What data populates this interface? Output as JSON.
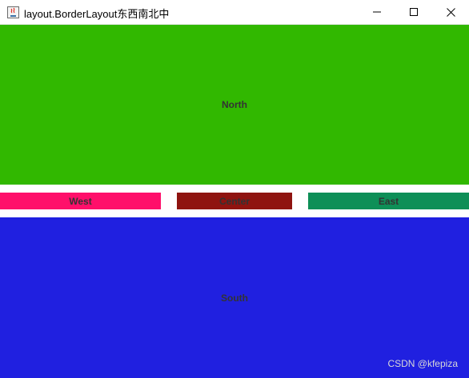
{
  "window": {
    "title": "layout.BorderLayout东西南北中",
    "icon": "java-icon",
    "controls": [
      "minimize-icon",
      "maximize-icon",
      "close-icon"
    ]
  },
  "regions": {
    "north": {
      "label": "North",
      "color": "#31b800"
    },
    "west": {
      "label": "West",
      "color": "#ff0f6a"
    },
    "center": {
      "label": "Center",
      "color": "#8f1410"
    },
    "east": {
      "label": "East",
      "color": "#0e8f57"
    },
    "south": {
      "label": "South",
      "color": "#2020e0"
    }
  },
  "watermark": "CSDN @kfepiza"
}
